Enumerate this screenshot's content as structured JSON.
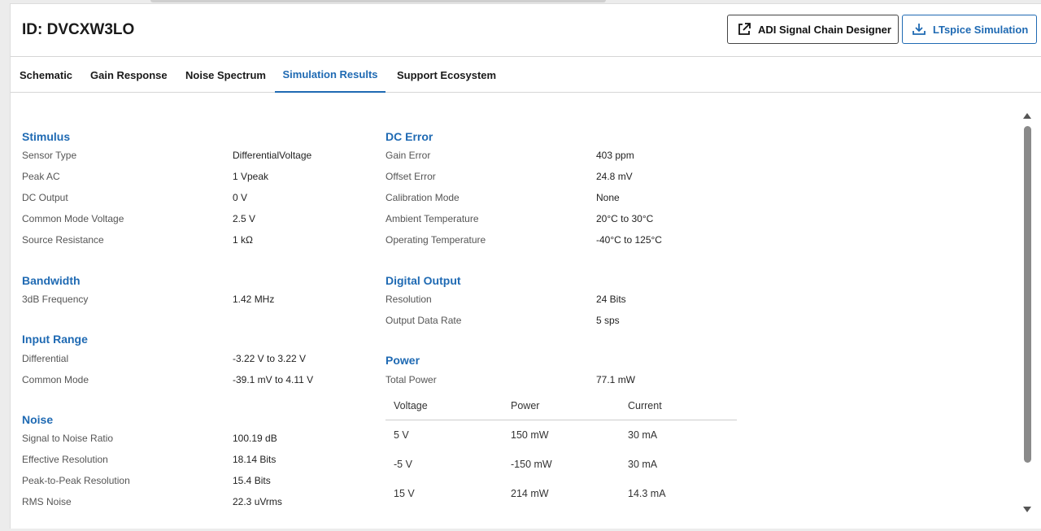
{
  "header": {
    "title": "ID: DVCXW3LO",
    "buttons": [
      {
        "label": "ADI Signal Chain Designer",
        "icon": "external-link-icon"
      },
      {
        "label": "LTspice Simulation",
        "icon": "download-icon"
      }
    ]
  },
  "tabs": [
    {
      "label": "Schematic"
    },
    {
      "label": "Gain Response"
    },
    {
      "label": "Noise Spectrum"
    },
    {
      "label": "Simulation Results",
      "active": true
    },
    {
      "label": "Support Ecosystem"
    }
  ],
  "sections": {
    "stimulus": {
      "title": "Stimulus",
      "rows": [
        {
          "label": "Sensor Type",
          "value": "DifferentialVoltage"
        },
        {
          "label": "Peak AC",
          "value": "1 Vpeak"
        },
        {
          "label": "DC Output",
          "value": "0 V"
        },
        {
          "label": "Common Mode Voltage",
          "value": "2.5 V"
        },
        {
          "label": "Source Resistance",
          "value": "1 kΩ"
        }
      ]
    },
    "bandwidth": {
      "title": "Bandwidth",
      "rows": [
        {
          "label": "3dB Frequency",
          "value": "1.42 MHz"
        }
      ]
    },
    "input_range": {
      "title": "Input Range",
      "rows": [
        {
          "label": "Differential",
          "value": "-3.22 V to 3.22 V"
        },
        {
          "label": "Common Mode",
          "value": "-39.1 mV to 4.11 V"
        }
      ]
    },
    "noise": {
      "title": "Noise",
      "rows": [
        {
          "label": "Signal to Noise Ratio",
          "value": "100.19 dB"
        },
        {
          "label": "Effective Resolution",
          "value": "18.14 Bits"
        },
        {
          "label": "Peak-to-Peak Resolution",
          "value": "15.4 Bits"
        },
        {
          "label": "RMS Noise",
          "value": "22.3 uVrms"
        }
      ]
    },
    "dc_error": {
      "title": "DC Error",
      "rows": [
        {
          "label": "Gain Error",
          "value": "403 ppm"
        },
        {
          "label": "Offset Error",
          "value": "24.8 mV"
        },
        {
          "label": "Calibration Mode",
          "value": "None"
        },
        {
          "label": "Ambient Temperature",
          "value": "20°C to 30°C"
        },
        {
          "label": "Operating Temperature",
          "value": "-40°C to 125°C"
        }
      ]
    },
    "digital_output": {
      "title": "Digital Output",
      "rows": [
        {
          "label": "Resolution",
          "value": "24 Bits"
        },
        {
          "label": "Output Data Rate",
          "value": "5 sps"
        }
      ]
    },
    "power": {
      "title": "Power",
      "rows": [
        {
          "label": "Total Power",
          "value": "77.1 mW"
        }
      ],
      "table": {
        "columns": [
          "Voltage",
          "Power",
          "Current"
        ],
        "rows": [
          [
            "5 V",
            "150 mW",
            "30 mA"
          ],
          [
            "-5 V",
            "-150 mW",
            "30 mA"
          ],
          [
            "15 V",
            "214 mW",
            "14.3 mA"
          ]
        ]
      }
    }
  },
  "colors": {
    "accent": "#1f6ab3",
    "border": "#d6d6d6"
  }
}
